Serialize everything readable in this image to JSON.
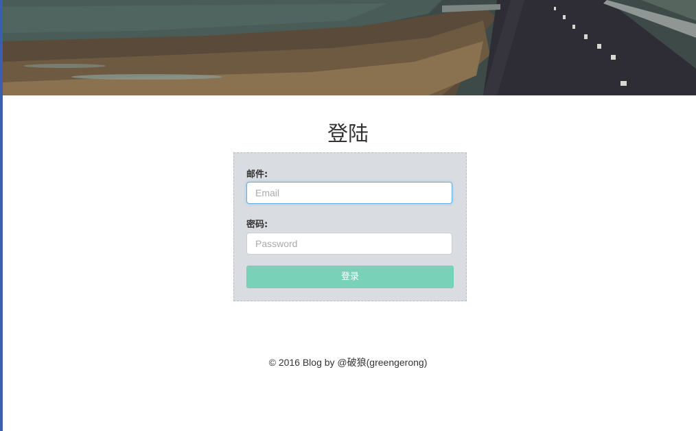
{
  "header": {
    "banner_image": "coastal-road-landscape"
  },
  "login": {
    "title": "登陆",
    "email_label": "邮件:",
    "email_placeholder": "Email",
    "email_value": "",
    "password_label": "密码:",
    "password_placeholder": "Password",
    "password_value": "",
    "submit_label": "登录"
  },
  "footer": {
    "text": "© 2016 Blog by @破狼(greengerong)"
  },
  "colors": {
    "accent": "#79d2b8",
    "panel": "#d9dde1",
    "focus": "#66afe9"
  }
}
